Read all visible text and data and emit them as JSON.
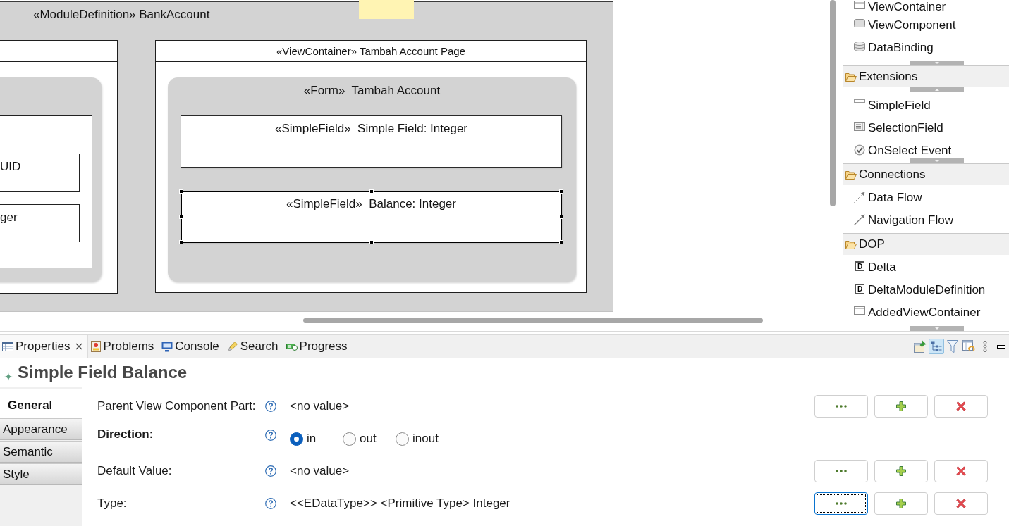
{
  "diagram": {
    "module": {
      "title": "«ModuleDefinition» BankAccount"
    },
    "left_container": {
      "fields": [
        {
          "text": "UID"
        },
        {
          "text": "ger"
        }
      ]
    },
    "view_container": {
      "title": "«ViewContainer» Tambah Account Page",
      "form": {
        "title": "«Form»  Tambah Account",
        "fields": [
          {
            "label": "«SimpleField»  Simple Field: Integer",
            "selected": false
          },
          {
            "label": "«SimpleField»  Balance: Integer",
            "selected": true
          }
        ]
      }
    }
  },
  "palette": {
    "drawers": [
      {
        "more_above": false,
        "more_below": true,
        "items": [
          {
            "label": "ViewContainer",
            "kind": "window"
          },
          {
            "label": "ViewComponent",
            "kind": "component"
          },
          {
            "label": "DataBinding",
            "kind": "database"
          }
        ]
      },
      {
        "title": "Extensions",
        "expanded": true,
        "more_above": true,
        "more_below": true,
        "items": [
          {
            "label": "SimpleField",
            "kind": "field"
          },
          {
            "label": "SelectionField",
            "kind": "list"
          },
          {
            "label": "OnSelect Event",
            "kind": "check"
          }
        ]
      },
      {
        "title": "Connections",
        "expanded": true,
        "more_above": false,
        "more_below": false,
        "items": [
          {
            "label": "Data Flow",
            "kind": "dashed"
          },
          {
            "label": "Navigation Flow",
            "kind": "arrow"
          }
        ]
      },
      {
        "title": "DOP",
        "expanded": true,
        "more_above": false,
        "more_below": true,
        "items": [
          {
            "label": "Delta",
            "kind": "letter",
            "icon_text": "D"
          },
          {
            "label": "DeltaModuleDefinition",
            "kind": "letter",
            "icon_text": "D"
          },
          {
            "label": "AddedViewContainer",
            "kind": "window"
          }
        ]
      }
    ]
  },
  "properties_view": {
    "tabs": [
      {
        "label": "Properties",
        "kind": "properties",
        "selected": true
      },
      {
        "label": "Problems",
        "kind": "problems",
        "selected": false
      },
      {
        "label": "Console",
        "kind": "console",
        "selected": false
      },
      {
        "label": "Search",
        "kind": "search",
        "selected": false
      },
      {
        "label": "Progress",
        "kind": "progress",
        "selected": false
      }
    ],
    "toolbar": [
      {
        "kind": "pin",
        "on": false
      },
      {
        "kind": "tree",
        "on": true
      },
      {
        "kind": "filter",
        "on": false
      },
      {
        "kind": "restore",
        "on": false
      },
      {
        "kind": "menu",
        "on": false
      },
      {
        "kind": "minimize",
        "on": false
      }
    ],
    "title": "Simple Field Balance",
    "sections": [
      {
        "label": "General",
        "selected": true
      },
      {
        "label": "Appearance",
        "selected": false
      },
      {
        "label": "Semantic",
        "selected": false
      },
      {
        "label": "Style",
        "selected": false
      }
    ],
    "fields": [
      {
        "kind": "reference",
        "label": "Parent View Component Part:",
        "required": false,
        "value": "<no value>",
        "buttons": [
          {
            "kind": "browse",
            "focused": false
          },
          {
            "kind": "add",
            "focused": false
          },
          {
            "kind": "remove",
            "focused": false
          }
        ]
      },
      {
        "kind": "choice",
        "label": "Direction:",
        "required": true,
        "options": [
          {
            "label": "in",
            "selected": true
          },
          {
            "label": "out",
            "selected": false
          },
          {
            "label": "inout",
            "selected": false
          }
        ]
      },
      {
        "kind": "reference",
        "label": "Default Value:",
        "required": false,
        "value": "<no value>",
        "buttons": [
          {
            "kind": "browse",
            "focused": false
          },
          {
            "kind": "add",
            "focused": false
          },
          {
            "kind": "remove",
            "focused": false
          }
        ]
      },
      {
        "kind": "reference",
        "label": "Type:",
        "required": false,
        "value": "<<EDataType>> <Primitive Type> Integer",
        "buttons": [
          {
            "kind": "browse",
            "focused": true
          },
          {
            "kind": "add",
            "focused": false
          },
          {
            "kind": "remove",
            "focused": false
          }
        ]
      }
    ]
  }
}
